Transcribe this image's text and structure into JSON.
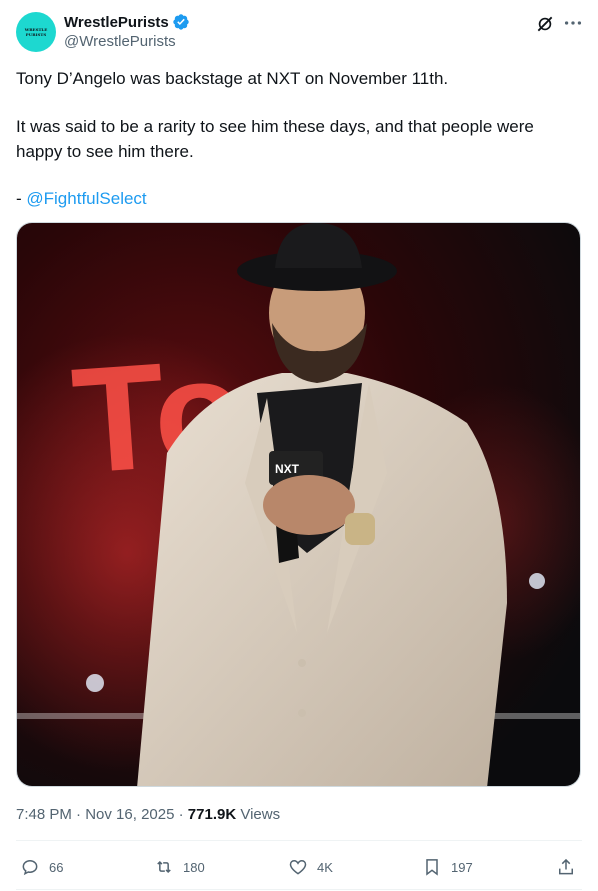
{
  "author": {
    "display_name": "WrestlePurists",
    "handle": "@WrestlePurists",
    "avatar_text": "WRESTLE\nPURISTS",
    "verified": true
  },
  "tweet": {
    "line1": "Tony D’Angelo was backstage at NXT on November 11th.",
    "line2": "It was said to be a rarity to see him these days, and that people were",
    "line3": "happy to see him there.",
    "source_prefix": "- ",
    "source_mention": "@FightfulSelect"
  },
  "media": {
    "backdrop_letters": "Ton",
    "mic_flag": "NXT"
  },
  "meta": {
    "time": "7:48 PM",
    "date": "Nov 16, 2025",
    "separator": " · ",
    "views_count": "771.9K",
    "views_label": "Views"
  },
  "actions": {
    "replies": "66",
    "reposts": "180",
    "likes": "4K",
    "bookmarks": "197"
  },
  "colors": {
    "accent": "#1d9bf0",
    "secondary_text": "#536471",
    "primary_text": "#0f1419",
    "avatar_bg": "#1dd8d0"
  },
  "icons": [
    "verified-badge-icon",
    "grok-icon",
    "more-icon",
    "reply-icon",
    "repost-icon",
    "like-icon",
    "bookmark-icon",
    "share-icon"
  ]
}
